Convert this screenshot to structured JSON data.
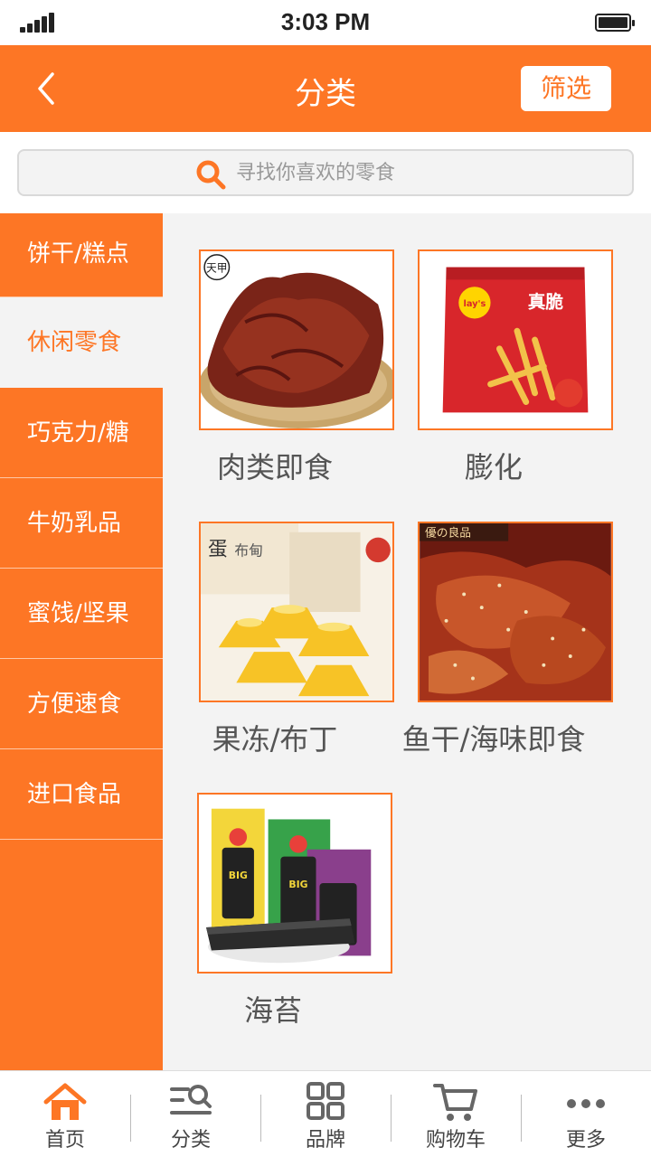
{
  "status_bar": {
    "time": "3:03 PM"
  },
  "header": {
    "title": "分类",
    "filter_label": "筛选"
  },
  "search": {
    "placeholder": "寻找你喜欢的零食"
  },
  "sidebar": {
    "items": [
      {
        "label": "饼干/糕点"
      },
      {
        "label": "休闲零食",
        "active": true
      },
      {
        "label": "巧克力/糖"
      },
      {
        "label": "牛奶乳品"
      },
      {
        "label": "蜜饯/坚果"
      },
      {
        "label": "方便速食"
      },
      {
        "label": "进口食品"
      }
    ]
  },
  "products": [
    {
      "label": "肉类即食",
      "image": "beef-jerky",
      "image_text": "天甲"
    },
    {
      "label": "膨化",
      "image": "lays-chips-bag",
      "image_text": "lay's乐事 真脆 薯条"
    },
    {
      "label": "果冻/布丁",
      "image": "pudding",
      "image_text": "蛋 布甸"
    },
    {
      "label": "鱼干/海味即食",
      "image": "dried-fish",
      "image_text": "優の良品"
    },
    {
      "label": "海苔",
      "image": "seaweed",
      "image_text": "BIG ROLL"
    }
  ],
  "bottom_nav": {
    "items": [
      {
        "label": "首页",
        "icon": "home-icon"
      },
      {
        "label": "分类",
        "icon": "category-search-icon"
      },
      {
        "label": "品牌",
        "icon": "grid-icon"
      },
      {
        "label": "购物车",
        "icon": "cart-icon"
      },
      {
        "label": "更多",
        "icon": "more-icon"
      }
    ]
  },
  "colors": {
    "accent": "#fd7625",
    "content_bg": "#f3f3f3"
  }
}
